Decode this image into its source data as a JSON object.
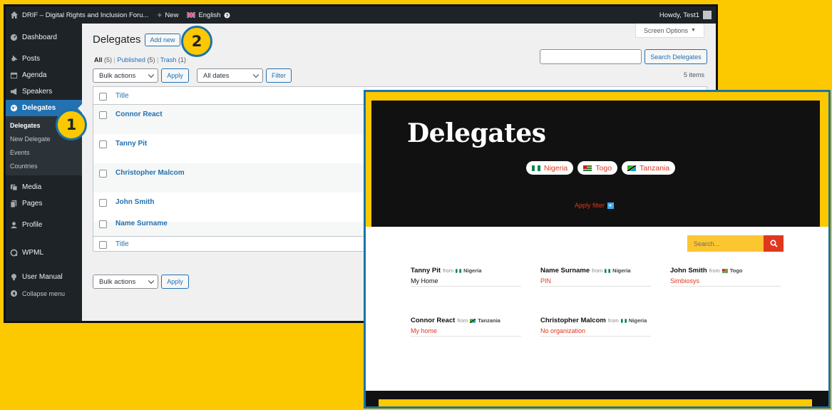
{
  "admin_bar": {
    "site_name": "DRIF – Digital Rights and Inclusion Foru...",
    "new_label": "New",
    "language_label": "English",
    "howdy_label": "Howdy, Test1"
  },
  "sidebar": {
    "items": [
      {
        "label": "Dashboard",
        "icon": "dashboard-icon"
      },
      {
        "label": "Posts",
        "icon": "pin-icon"
      },
      {
        "label": "Agenda",
        "icon": "calendar-icon"
      },
      {
        "label": "Speakers",
        "icon": "megaphone-icon"
      },
      {
        "label": "Delegates",
        "icon": "globe-icon"
      },
      {
        "label": "Media",
        "icon": "media-icon"
      },
      {
        "label": "Pages",
        "icon": "pages-icon"
      },
      {
        "label": "Profile",
        "icon": "user-icon"
      },
      {
        "label": "WPML",
        "icon": "wpml-icon"
      },
      {
        "label": "User Manual",
        "icon": "lightbulb-icon"
      },
      {
        "label": "Collapse menu",
        "icon": "collapse-icon"
      }
    ],
    "submenu": [
      "Delegates",
      "New Delegate",
      "Events",
      "Countries"
    ]
  },
  "main": {
    "page_title": "Delegates",
    "add_new_label": "Add new",
    "screen_options_label": "Screen Options",
    "filters": {
      "all": "All",
      "all_count": "(5)",
      "published": "Published",
      "published_count": "(5)",
      "trash": "Trash",
      "trash_count": "(1)"
    },
    "search_button_label": "Search Delegates",
    "bulk_actions_label": "Bulk actions",
    "apply_label": "Apply",
    "dates_label": "All dates",
    "filter_label": "Filter",
    "items_count": "5 items",
    "table": {
      "title_header": "Title",
      "rows": [
        "Connor React",
        "Tanny Pit",
        "Christopher Malcom",
        "John Smith",
        "Name Surname"
      ]
    }
  },
  "callouts": {
    "one": "1",
    "two": "2"
  },
  "frontend": {
    "hero_title": "Delegates",
    "country_filters": [
      {
        "label": "Nigeria",
        "flag": "nigeria-flag"
      },
      {
        "label": "Togo",
        "flag": "togo-flag"
      },
      {
        "label": "Tanzania",
        "flag": "tanzania-flag"
      }
    ],
    "apply_filter_label": "Apply filter",
    "search_placeholder": "Search...",
    "from_label": "from",
    "delegates": [
      {
        "name": "Tanny Pit",
        "country": "Nigeria",
        "org": "My Home"
      },
      {
        "name": "Name Surname",
        "country": "Nigeria",
        "org": "PIN"
      },
      {
        "name": "John Smith",
        "country": "Togo",
        "org": "Simbiosys"
      },
      {
        "name": "Connor React",
        "country": "Tanzania",
        "org": "My home"
      },
      {
        "name": "Christopher Malcom",
        "country": "Nigeria",
        "org": "No organization"
      }
    ]
  },
  "colors": {
    "wp_blue": "#2271b1",
    "wp_dark": "#1d2327",
    "brand_yellow": "#fcc800",
    "accent_red": "#e0371f",
    "callout_border": "#1a73a9"
  }
}
